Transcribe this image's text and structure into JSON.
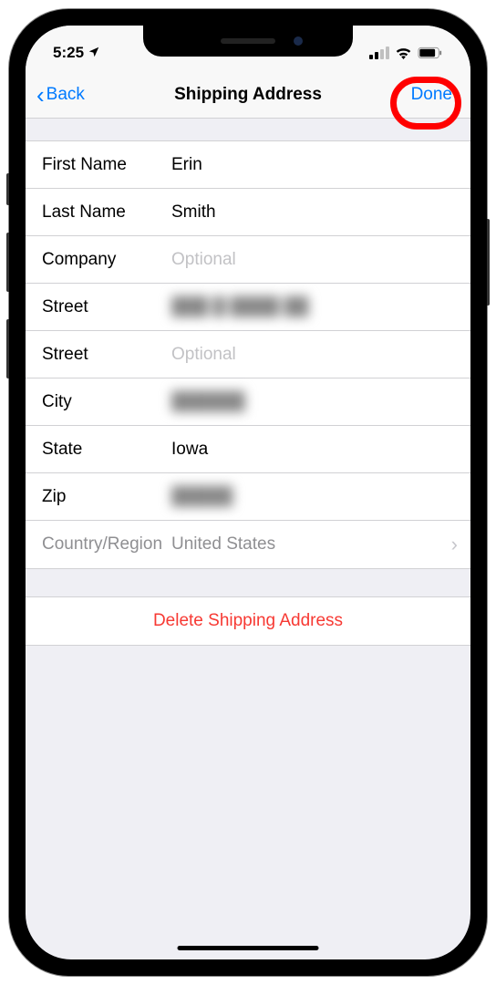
{
  "status": {
    "time": "5:25",
    "location_icon": "location-arrow"
  },
  "nav": {
    "back_label": "Back",
    "title": "Shipping Address",
    "done_label": "Done"
  },
  "form": {
    "first_name": {
      "label": "First Name",
      "value": "Erin"
    },
    "last_name": {
      "label": "Last Name",
      "value": "Smith"
    },
    "company": {
      "label": "Company",
      "value": "",
      "placeholder": "Optional"
    },
    "street1": {
      "label": "Street",
      "value": "███ █ ████ ██"
    },
    "street2": {
      "label": "Street",
      "value": "",
      "placeholder": "Optional"
    },
    "city": {
      "label": "City",
      "value": "██████"
    },
    "state": {
      "label": "State",
      "value": "Iowa"
    },
    "zip": {
      "label": "Zip",
      "value": "█████"
    },
    "country": {
      "label": "Country/Region",
      "value": "United States"
    }
  },
  "delete_label": "Delete Shipping Address"
}
